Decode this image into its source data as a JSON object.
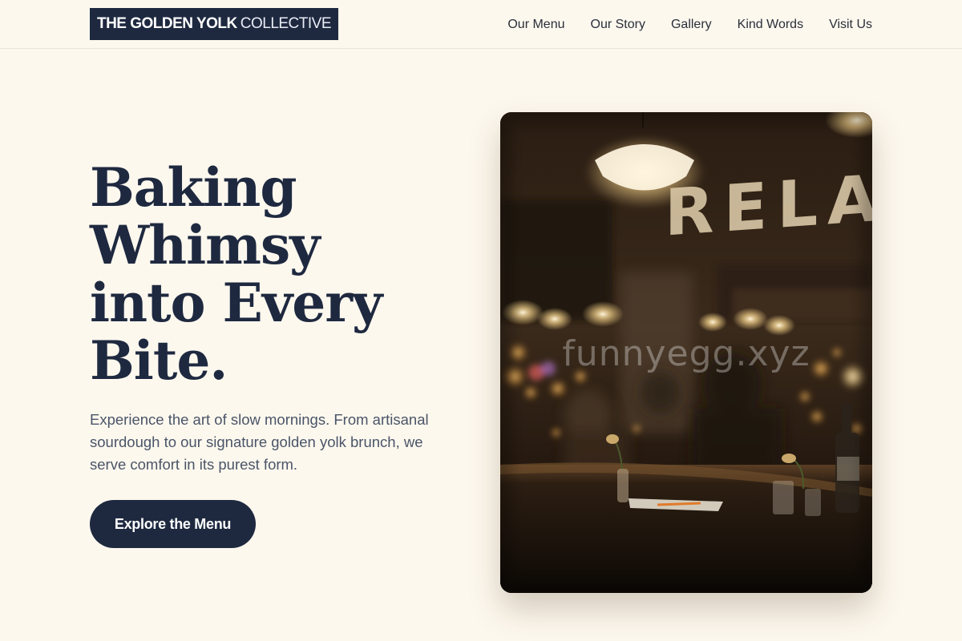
{
  "brand": {
    "name_strong": "THE GOLDEN YOLK",
    "name_light": "COLLECTIVE"
  },
  "nav": {
    "items": [
      {
        "label": "Our Menu"
      },
      {
        "label": "Our Story"
      },
      {
        "label": "Gallery"
      },
      {
        "label": "Kind Words"
      },
      {
        "label": "Visit Us"
      }
    ]
  },
  "hero": {
    "title_lines": [
      "Baking",
      "Whimsy",
      "into Every",
      "Bite."
    ],
    "description": "Experience the art of slow mornings. From artisanal sourdough to our signature golden yolk brunch, we serve comfort in its purest form.",
    "cta_label": "Explore the Menu"
  },
  "image": {
    "sign_text": "RELAX",
    "watermark": "funnyegg.xyz"
  },
  "colors": {
    "background": "#fdf8ee",
    "navy": "#1e2940",
    "body_text": "#4a5568"
  }
}
